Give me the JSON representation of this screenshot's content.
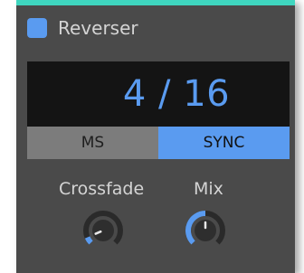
{
  "device": {
    "title": "Reverser",
    "enabled": true,
    "accent_color": "#3fd6bf",
    "toggle_color": "#5a9bf0"
  },
  "display": {
    "value": "4 / 16"
  },
  "mode": {
    "options": [
      "MS",
      "SYNC"
    ],
    "selected": "SYNC",
    "active_color": "#5a9bf0"
  },
  "knobs": {
    "crossfade": {
      "label": "Crossfade",
      "value": 0.08
    },
    "mix": {
      "label": "Mix",
      "value": 0.5
    }
  }
}
